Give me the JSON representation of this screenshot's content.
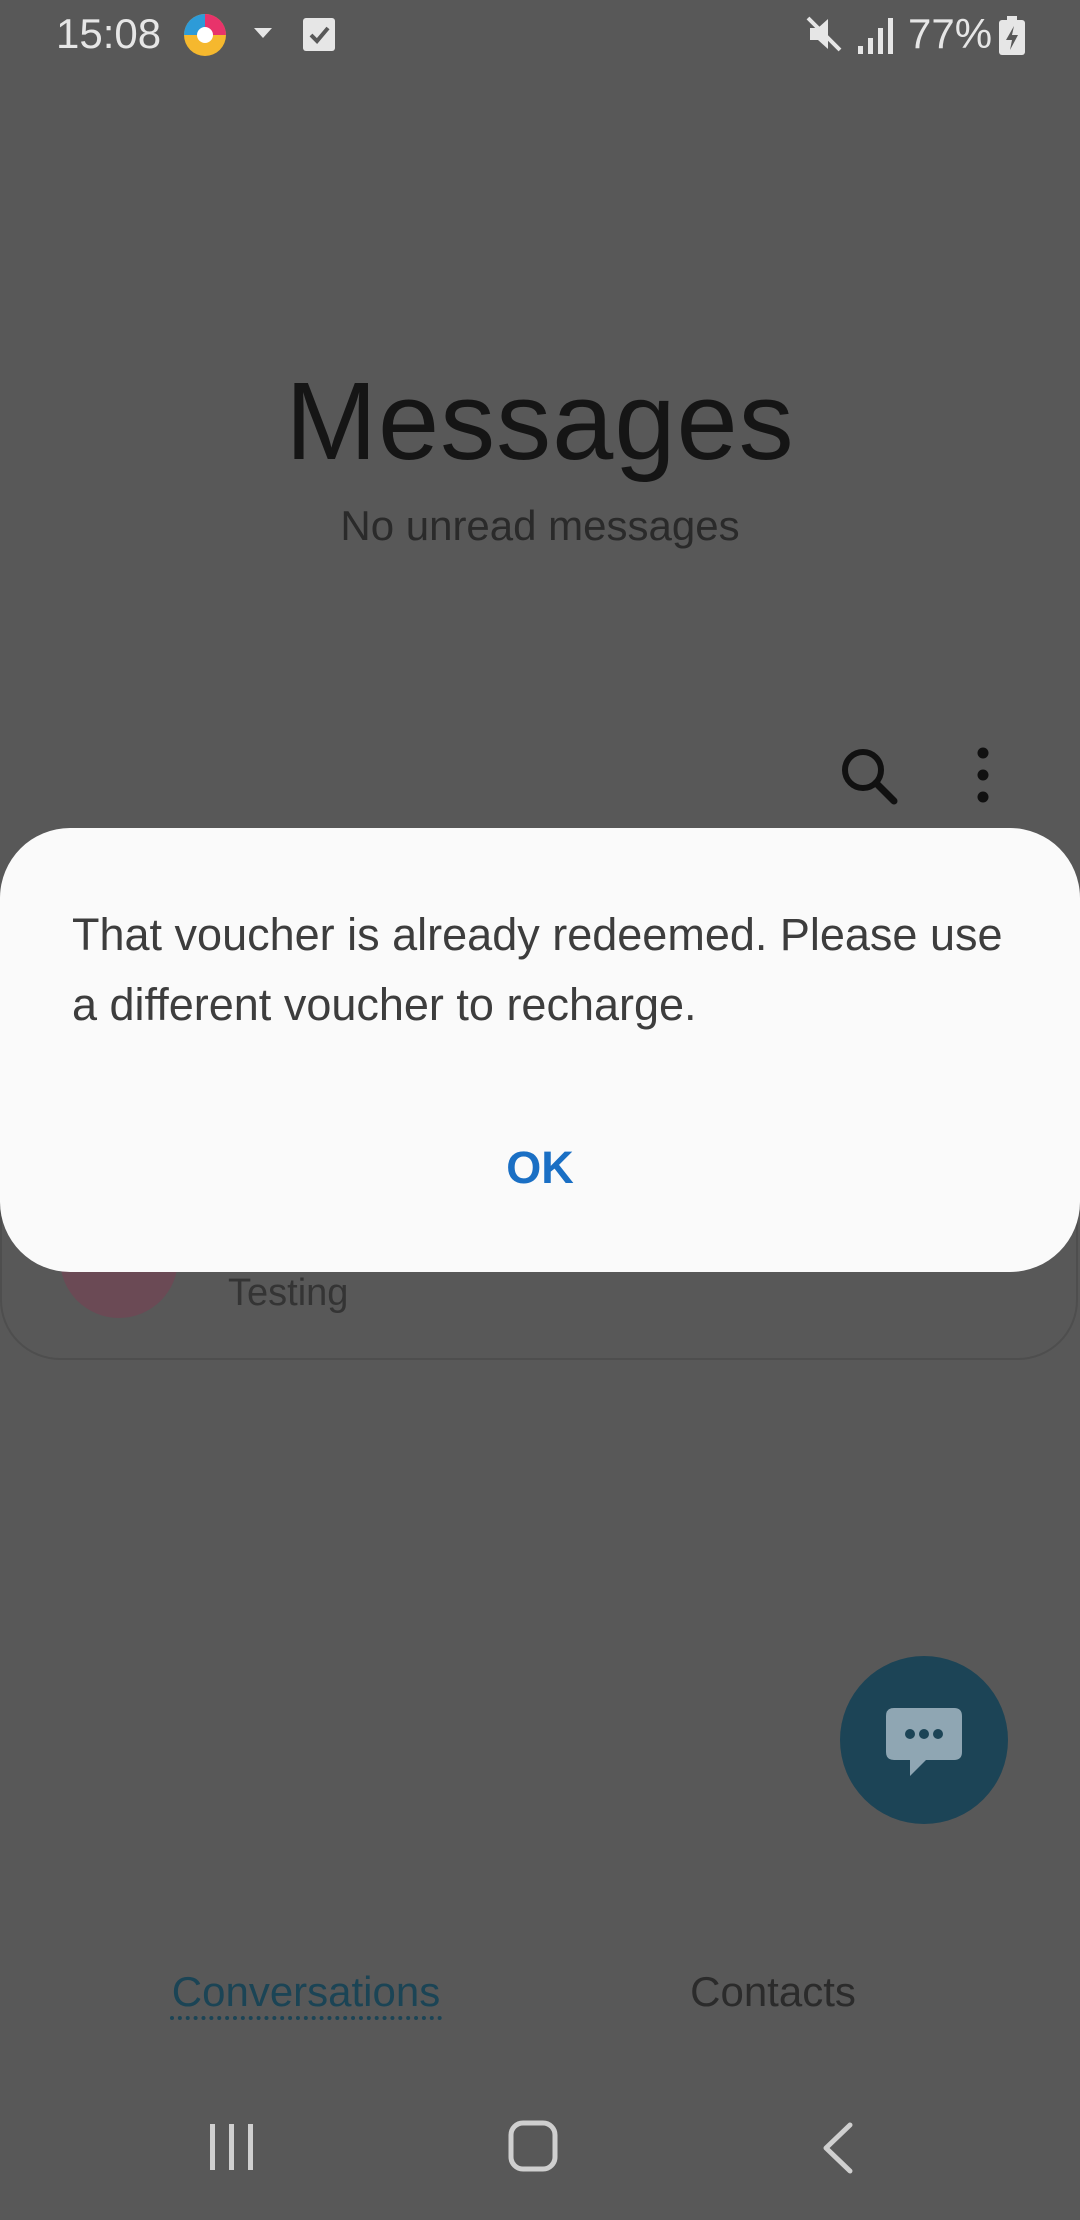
{
  "status_bar": {
    "time": "15:08",
    "battery_percent": "77%",
    "icons": [
      "app-notification-icon",
      "dropdown-icon",
      "check-icon",
      "mute-icon",
      "signal-icon",
      "battery-charging-icon"
    ]
  },
  "header": {
    "title": "Messages",
    "subtitle": "No unread messages"
  },
  "toolbar": {
    "icons": [
      "search-icon",
      "more-options-icon"
    ]
  },
  "background_list": {
    "snippet": "Testing"
  },
  "dialog": {
    "message": "That voucher is already redeemed.  Please use a different voucher to recharge.",
    "ok_label": "OK"
  },
  "tabs": {
    "conversations": "Conversations",
    "contacts": "Contacts",
    "active": "Conversations"
  },
  "colors": {
    "dialog_button": "#1a6fc4",
    "fab": "#1c4456",
    "active_tab": "#1b4455",
    "scrim_background": "#585858"
  }
}
